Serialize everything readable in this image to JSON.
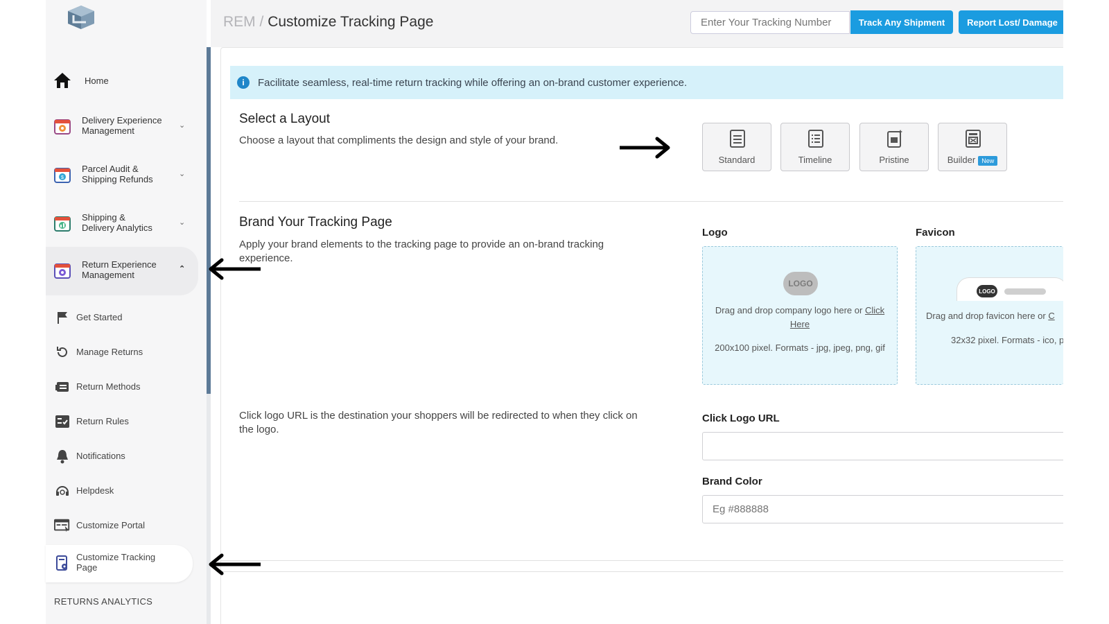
{
  "header": {
    "crumb_root": "REM",
    "crumb_sep": " / ",
    "title": "Customize Tracking Page",
    "tracking_placeholder": "Enter Your Tracking Number",
    "track_button": "Track Any Shipment",
    "report_button": "Report Lost/ Damage"
  },
  "sidebar": {
    "items": [
      {
        "label": "Home",
        "icon": "home-icon"
      },
      {
        "label_1": "Delivery Experience",
        "label_2": "Management",
        "icon": "delivery-icon"
      },
      {
        "label_1": "Parcel Audit &",
        "label_2": "Shipping Refunds",
        "icon": "audit-icon"
      },
      {
        "label_1": "Shipping &",
        "label_2": "Delivery Analytics",
        "icon": "analytics-icon"
      },
      {
        "label_1": "Return Experience",
        "label_2": "Management",
        "icon": "return-icon"
      }
    ],
    "sub_items": [
      {
        "label": "Get Started",
        "icon": "flag-icon"
      },
      {
        "label": "Manage Returns",
        "icon": "refresh-icon"
      },
      {
        "label": "Return Methods",
        "icon": "methods-icon"
      },
      {
        "label": "Return Rules",
        "icon": "rules-icon"
      },
      {
        "label": "Notifications",
        "icon": "bell-icon"
      },
      {
        "label": "Helpdesk",
        "icon": "headset-icon"
      },
      {
        "label": "Customize Portal",
        "icon": "portal-icon"
      },
      {
        "label_1": "Customize Tracking",
        "label_2": "Page",
        "icon": "tracking-page-icon"
      }
    ],
    "section_heading": "RETURNS ANALYTICS"
  },
  "info_banner": "Facilitate seamless, real-time return tracking while offering an on-brand customer experience.",
  "layout_section": {
    "title": "Select a Layout",
    "description": "Choose a layout that compliments the design and style of your brand.",
    "options": [
      {
        "label": "Standard"
      },
      {
        "label": "Timeline"
      },
      {
        "label": "Pristine"
      },
      {
        "label": "Builder",
        "badge": "New"
      }
    ]
  },
  "brand_section": {
    "title": "Brand Your Tracking Page",
    "description_1": "Apply your brand elements to the tracking page to provide an on-brand tracking",
    "description_2": "experience.",
    "logo_label": "Logo",
    "logo_placeholder_text": "LOGO",
    "logo_drop_text": "Drag and drop company logo here or ",
    "logo_click_1": "Click",
    "logo_click_2": "Here",
    "logo_formats": "200x100 pixel. Formats - jpg, jpeg, png, gif",
    "favicon_label": "Favicon",
    "favicon_logo_text": "LOGO",
    "favicon_drop_text": "Drag and drop favicon here or ",
    "favicon_click": "C",
    "favicon_formats": "32x32 pixel. Formats - ico, p",
    "click_logo_desc_1": "Click logo URL is the destination your shoppers will be redirected to when they click on",
    "click_logo_desc_2": "the logo.",
    "click_logo_label": "Click Logo URL",
    "click_logo_value": "",
    "brand_color_label": "Brand Color",
    "brand_color_placeholder": "Eg #888888"
  },
  "colors": {
    "accent": "#1b9ce0",
    "info_bg": "#d6f1fa",
    "scrollbar": "#5d7a97"
  }
}
